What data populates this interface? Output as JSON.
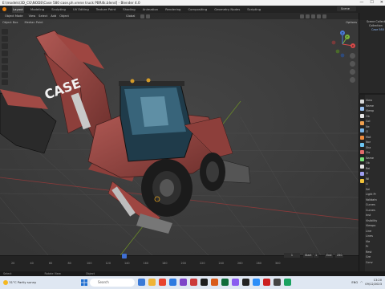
{
  "window": {
    "title": "E:\\models\\3D_CG\\NODE\\Case 580 case.ph.vrene truck PBR4k.blend] - Blender 4.0",
    "controls": [
      "—",
      "☐",
      "✕"
    ]
  },
  "menubar": {
    "tabs": [
      {
        "label": "Layout",
        "active": true
      },
      {
        "label": "Modeling",
        "active": false
      },
      {
        "label": "Sculpting",
        "active": false
      },
      {
        "label": "UV Editing",
        "active": false
      },
      {
        "label": "Texture Paint",
        "active": false
      },
      {
        "label": "Shading",
        "active": false
      },
      {
        "label": "Animation",
        "active": false
      },
      {
        "label": "Rendering",
        "active": false
      },
      {
        "label": "Compositing",
        "active": false
      },
      {
        "label": "Geometry Nodes",
        "active": false
      },
      {
        "label": "Scripting",
        "active": false
      }
    ],
    "scene_label": "Scene"
  },
  "viewport": {
    "header": {
      "mode": "Object Mode",
      "menus": [
        "View",
        "Select",
        "Add",
        "Object"
      ],
      "orientation": "Global",
      "options": "Options"
    },
    "subheader": {
      "view_label": "Object Box",
      "pivot": "Median Point"
    },
    "gizmo": {
      "x_label": "X",
      "y_label": "Y",
      "z_label": "Z"
    },
    "object_text": "CASE"
  },
  "outliner": {
    "rows": [
      "Scene Collection",
      "Collection",
      "Case 580"
    ]
  },
  "properties": {
    "items": [
      "View",
      "Name",
      "Viewp",
      "Ob",
      "Col",
      "Ne",
      "Cl",
      "Mat",
      "Nor",
      "Sha",
      "Clo",
      "Name",
      "Ob",
      "Rei",
      "Vi",
      "Wi",
      "Li",
      "Sel",
      "Light Pr",
      "Validatn",
      "Curves",
      "Curves",
      "Inst",
      "Visibility",
      "Viewpo",
      "Line",
      "Lines",
      "Vie",
      "Pr",
      "Rest",
      "Gre",
      "Conv"
    ],
    "tab_colors": [
      "#d9d9d9",
      "#9bc1f0",
      "#e6e6e6",
      "#f0a050",
      "#7ab4e8",
      "#ee8a3c",
      "#6dc5f2",
      "#e26b6b",
      "#7ae07a",
      "#e5e5e5",
      "#9e9ef0",
      "#f0c23a"
    ]
  },
  "timeline": {
    "ticks": [
      "20",
      "40",
      "60",
      "80",
      "100",
      "120",
      "140",
      "160",
      "180",
      "200",
      "220",
      "240",
      "260",
      "280",
      "300"
    ],
    "current_frame": "1",
    "start_label": "Start",
    "start": "1",
    "end_label": "End",
    "end": "250"
  },
  "statusbar": {
    "left": "Select",
    "mid": "Rotate View",
    "right": "Object"
  },
  "taskbar": {
    "weather_temp": "31°C",
    "weather_desc": "Partly sunny",
    "search_placeholder": "Search",
    "app_colors": [
      "#3a79d6",
      "#f0b437",
      "#e8432e",
      "#2d7ae0",
      "#7e44c8",
      "#cc3a3a",
      "#1e1e1e",
      "#d95b1a",
      "#0f6b3a",
      "#8a5cf0",
      "#222222",
      "#2c8ef8",
      "#cc2020",
      "#444444",
      "#1aa260"
    ],
    "time": "13:20",
    "date": "09/12/2023",
    "language": "ENG"
  }
}
